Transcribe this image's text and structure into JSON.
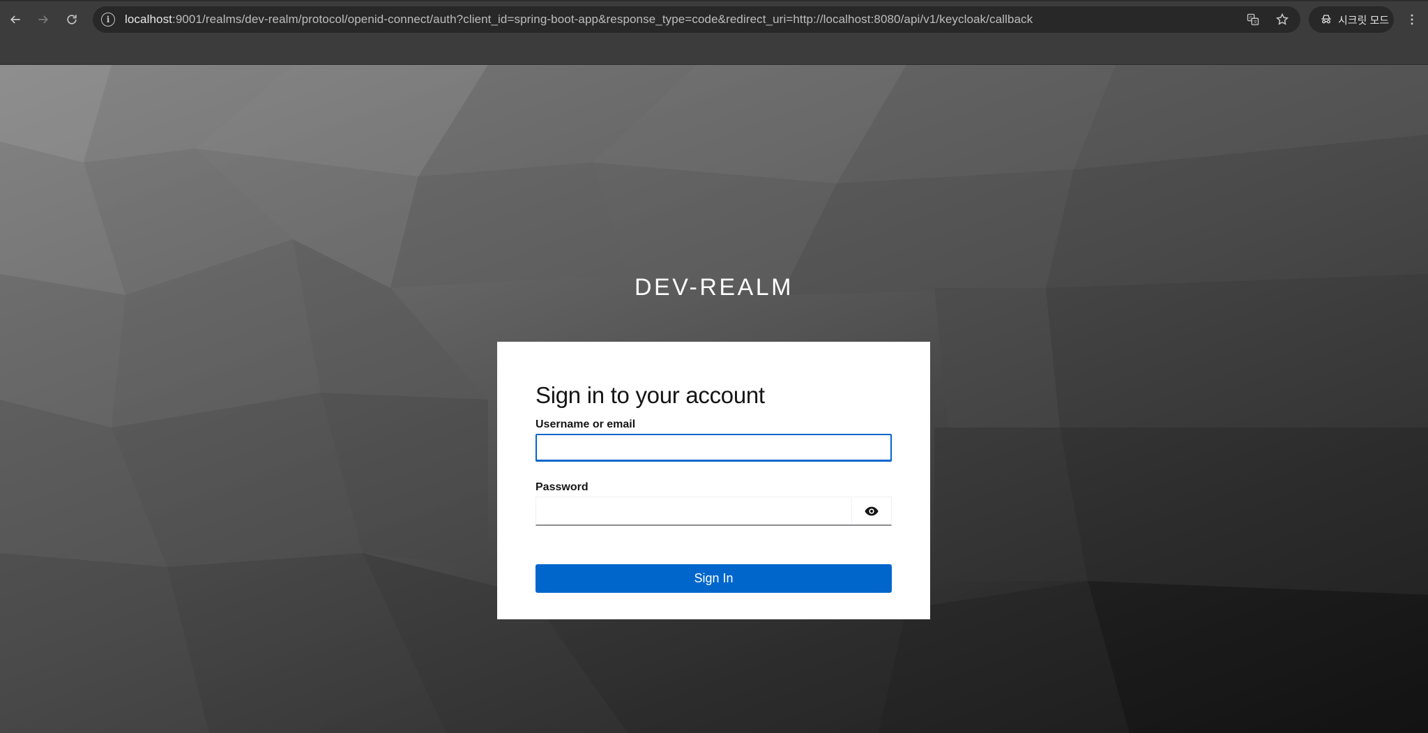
{
  "browser": {
    "url_host": "localhost",
    "url_rest": ":9001/realms/dev-realm/protocol/openid-connect/auth?client_id=spring-boot-app&response_type=code&redirect_uri=http://localhost:8080/api/v1/keycloak/callback",
    "incognito_label": "시크릿 모드",
    "icons": {
      "back": "arrow-left-icon",
      "forward": "arrow-right-icon",
      "reload": "reload-icon",
      "site_info": "info-icon",
      "translate": "translate-icon",
      "bookmark": "star-icon",
      "incognito": "incognito-icon",
      "menu": "kebab-menu-icon"
    }
  },
  "page": {
    "realm_name": "DEV-REALM",
    "card": {
      "title": "Sign in to your account",
      "username_label": "Username or email",
      "username_value": "",
      "password_label": "Password",
      "password_value": "",
      "submit_label": "Sign In"
    },
    "colors": {
      "primary": "#0066cc",
      "card_bg": "#ffffff",
      "title_text": "#ffffff"
    }
  }
}
